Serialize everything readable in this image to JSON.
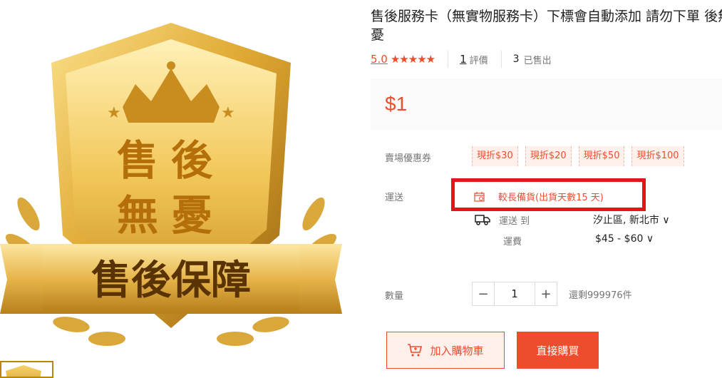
{
  "product": {
    "title": "售後服務卡（無實物服務卡）下標會自動添加 請勿下單 後無憂",
    "rating": "5.0",
    "stars": "★★★★★",
    "review_count": "1",
    "review_label": "評價",
    "sold_count": "3",
    "sold_label": "已售出",
    "price": "$1"
  },
  "image": {
    "badge_line1": "售後",
    "badge_line2": "無憂",
    "ribbon_text": "售後保障"
  },
  "coupons": {
    "label": "賣場優惠券",
    "items": [
      "現折$30",
      "現折$20",
      "現折$50",
      "現折$100"
    ]
  },
  "shipping": {
    "label": "運送",
    "notice": "較長備貨(出貨天數15 天)",
    "ship_to_label": "運送 到",
    "location": "汐止區, 新北市 ∨",
    "fee_label": "運費",
    "fee": "$45 - $60 ∨"
  },
  "quantity": {
    "label": "數量",
    "minus": "−",
    "value": "1",
    "plus": "+",
    "stock": "還剩999976件"
  },
  "actions": {
    "add_to_cart": "加入購物車",
    "buy_now": "直接購買"
  },
  "colors": {
    "accent": "#ee4d2d",
    "highlight_border": "#e3151a"
  }
}
